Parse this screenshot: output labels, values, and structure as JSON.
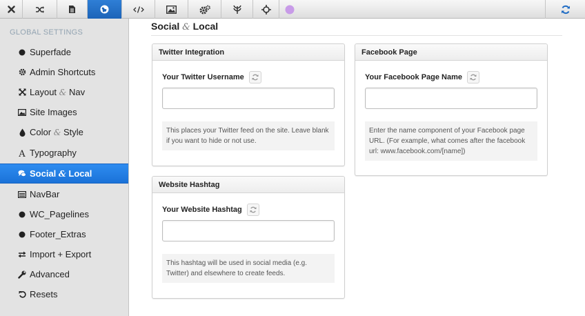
{
  "toolbar": {
    "buttons": [
      {
        "icon": "close-icon"
      },
      {
        "icon": "shuffle-icon"
      },
      {
        "icon": "document-icon"
      },
      {
        "icon": "globe-icon",
        "active": true
      },
      {
        "icon": "code-icon"
      },
      {
        "icon": "image-icon"
      },
      {
        "icon": "gears-icon"
      },
      {
        "icon": "leaf-icon"
      },
      {
        "icon": "move-icon"
      },
      {
        "icon": "purple-circle-icon",
        "color": "#c89be8"
      }
    ],
    "refresh_icon": "refresh-icon",
    "accent": "#1f6cc4"
  },
  "sidebar": {
    "title": "GLOBAL SETTINGS",
    "items": [
      {
        "label": "Superfade",
        "icon": "circle-icon"
      },
      {
        "label": "Admin Shortcuts",
        "icon": "gear-icon"
      },
      {
        "label_a": "Layout",
        "amp": "&",
        "label_b": "Nav",
        "icon": "expand-icon"
      },
      {
        "label": "Site Images",
        "icon": "picture-icon"
      },
      {
        "label_a": "Color",
        "amp": "&",
        "label_b": "Style",
        "icon": "tint-icon"
      },
      {
        "label": "Typography",
        "icon": "font-icon"
      },
      {
        "label_a": "Social",
        "amp": "&",
        "label_b": "Local",
        "icon": "comments-icon",
        "active": true
      },
      {
        "label": "NavBar",
        "icon": "list-icon"
      },
      {
        "label": "WC_Pagelines",
        "icon": "circle-icon"
      },
      {
        "label": "Footer_Extras",
        "icon": "circle-icon"
      },
      {
        "label": "Import + Export",
        "icon": "exchange-icon"
      },
      {
        "label": "Advanced",
        "icon": "wrench-icon"
      },
      {
        "label": "Resets",
        "icon": "undo-icon"
      }
    ],
    "active_color": "#1a72d8"
  },
  "main": {
    "title_a": "Social",
    "title_amp": "&",
    "title_b": "Local",
    "panels": {
      "twitter": {
        "heading": "Twitter Integration",
        "label": "Your Twitter Username",
        "value": "",
        "help": "This places your Twitter feed on the site. Leave blank if you want to hide or not use."
      },
      "facebook": {
        "heading": "Facebook Page",
        "label": "Your Facebook Page Name",
        "value": "",
        "help": "Enter the name component of your Facebook page URL. (For example, what comes after the facebook url: www.facebook.com/[name])"
      },
      "hashtag": {
        "heading": "Website Hashtag",
        "label": "Your Website Hashtag",
        "value": "",
        "help": "This hashtag will be used in social media (e.g. Twitter) and elsewhere to create feeds."
      }
    }
  }
}
